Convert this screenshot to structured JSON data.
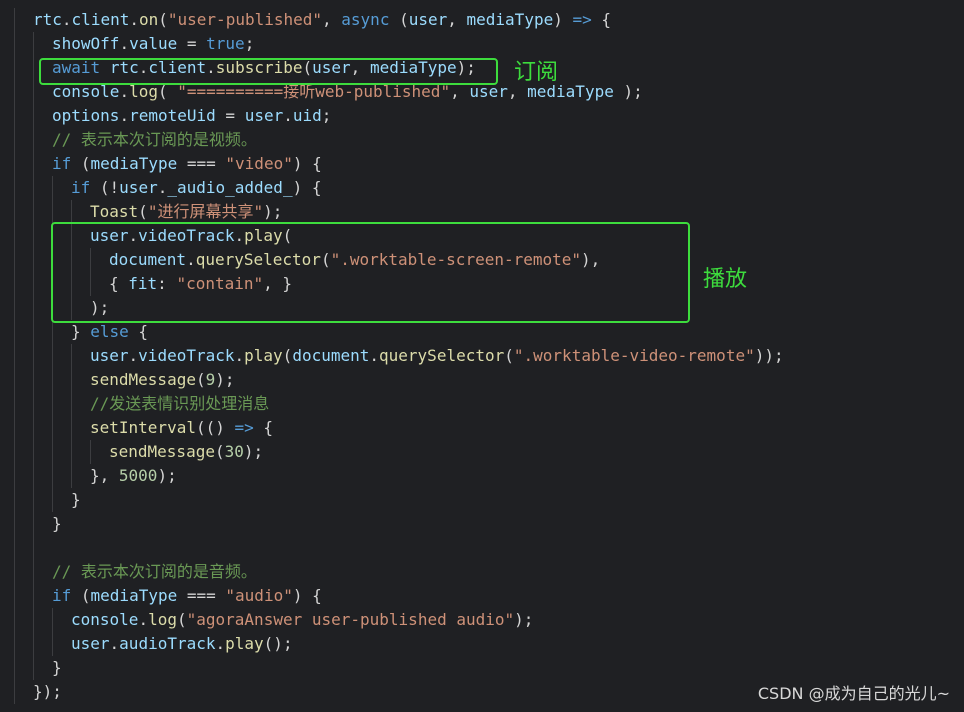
{
  "code": {
    "lines": [
      {
        "indent": 1,
        "tokens": [
          [
            "rtc",
            "var"
          ],
          [
            ".",
            "pun"
          ],
          [
            "client",
            "var"
          ],
          [
            ".",
            "pun"
          ],
          [
            "on",
            "fn"
          ],
          [
            "(",
            "pun"
          ],
          [
            "\"user-published\"",
            "str"
          ],
          [
            ", ",
            "pun"
          ],
          [
            "async",
            "kw"
          ],
          [
            " (",
            "pun"
          ],
          [
            "user",
            "var"
          ],
          [
            ", ",
            "pun"
          ],
          [
            "mediaType",
            "var"
          ],
          [
            ") ",
            "pun"
          ],
          [
            "=>",
            "kw"
          ],
          [
            " {",
            "pun"
          ]
        ]
      },
      {
        "indent": 2,
        "tokens": [
          [
            "showOff",
            "var"
          ],
          [
            ".",
            "pun"
          ],
          [
            "value",
            "var"
          ],
          [
            " = ",
            "pun"
          ],
          [
            "true",
            "kw"
          ],
          [
            ";",
            "pun"
          ]
        ]
      },
      {
        "indent": 2,
        "tokens": [
          [
            "await",
            "kw"
          ],
          [
            " ",
            "pun"
          ],
          [
            "rtc",
            "var"
          ],
          [
            ".",
            "pun"
          ],
          [
            "client",
            "var"
          ],
          [
            ".",
            "pun"
          ],
          [
            "subscribe",
            "fn"
          ],
          [
            "(",
            "pun"
          ],
          [
            "user",
            "var"
          ],
          [
            ", ",
            "pun"
          ],
          [
            "mediaType",
            "var"
          ],
          [
            ");",
            "pun"
          ]
        ]
      },
      {
        "indent": 2,
        "tokens": [
          [
            "console",
            "var"
          ],
          [
            ".",
            "pun"
          ],
          [
            "log",
            "fn"
          ],
          [
            "( ",
            "pun"
          ],
          [
            "\"==========接听web-published\"",
            "str"
          ],
          [
            ", ",
            "pun"
          ],
          [
            "user",
            "var"
          ],
          [
            ", ",
            "pun"
          ],
          [
            "mediaType",
            "var"
          ],
          [
            " );",
            "pun"
          ]
        ]
      },
      {
        "indent": 2,
        "tokens": [
          [
            "options",
            "var"
          ],
          [
            ".",
            "pun"
          ],
          [
            "remoteUid",
            "var"
          ],
          [
            " = ",
            "pun"
          ],
          [
            "user",
            "var"
          ],
          [
            ".",
            "pun"
          ],
          [
            "uid",
            "var"
          ],
          [
            ";",
            "pun"
          ]
        ]
      },
      {
        "indent": 2,
        "tokens": [
          [
            "// 表示本次订阅的是视频。",
            "cmt"
          ]
        ]
      },
      {
        "indent": 2,
        "tokens": [
          [
            "if",
            "kw"
          ],
          [
            " (",
            "pun"
          ],
          [
            "mediaType",
            "var"
          ],
          [
            " === ",
            "pun"
          ],
          [
            "\"video\"",
            "str"
          ],
          [
            ") {",
            "pun"
          ]
        ]
      },
      {
        "indent": 3,
        "tokens": [
          [
            "if",
            "kw"
          ],
          [
            " (!",
            "pun"
          ],
          [
            "user",
            "var"
          ],
          [
            ".",
            "pun"
          ],
          [
            "_audio_added_",
            "var"
          ],
          [
            ") {",
            "pun"
          ]
        ]
      },
      {
        "indent": 4,
        "tokens": [
          [
            "Toast",
            "fn"
          ],
          [
            "(",
            "pun"
          ],
          [
            "\"进行屏幕共享\"",
            "str"
          ],
          [
            ");",
            "pun"
          ]
        ]
      },
      {
        "indent": 4,
        "tokens": [
          [
            "user",
            "var"
          ],
          [
            ".",
            "pun"
          ],
          [
            "videoTrack",
            "var"
          ],
          [
            ".",
            "pun"
          ],
          [
            "play",
            "fn"
          ],
          [
            "(",
            "pun"
          ]
        ]
      },
      {
        "indent": 5,
        "tokens": [
          [
            "document",
            "var"
          ],
          [
            ".",
            "pun"
          ],
          [
            "querySelector",
            "fn"
          ],
          [
            "(",
            "pun"
          ],
          [
            "\".worktable-screen-remote\"",
            "str"
          ],
          [
            "),",
            "pun"
          ]
        ]
      },
      {
        "indent": 5,
        "tokens": [
          [
            "{ ",
            "pun"
          ],
          [
            "fit",
            "prop"
          ],
          [
            ": ",
            "pun"
          ],
          [
            "\"contain\"",
            "str"
          ],
          [
            ", }",
            "pun"
          ]
        ]
      },
      {
        "indent": 4,
        "tokens": [
          [
            ");",
            "pun"
          ]
        ]
      },
      {
        "indent": 3,
        "tokens": [
          [
            "} ",
            "pun"
          ],
          [
            "else",
            "kw"
          ],
          [
            " {",
            "pun"
          ]
        ]
      },
      {
        "indent": 4,
        "tokens": [
          [
            "user",
            "var"
          ],
          [
            ".",
            "pun"
          ],
          [
            "videoTrack",
            "var"
          ],
          [
            ".",
            "pun"
          ],
          [
            "play",
            "fn"
          ],
          [
            "(",
            "pun"
          ],
          [
            "document",
            "var"
          ],
          [
            ".",
            "pun"
          ],
          [
            "querySelector",
            "fn"
          ],
          [
            "(",
            "pun"
          ],
          [
            "\".worktable-video-remote\"",
            "str"
          ],
          [
            "));",
            "pun"
          ]
        ]
      },
      {
        "indent": 4,
        "tokens": [
          [
            "sendMessage",
            "fn"
          ],
          [
            "(",
            "pun"
          ],
          [
            "9",
            "num"
          ],
          [
            ");",
            "pun"
          ]
        ]
      },
      {
        "indent": 4,
        "tokens": [
          [
            "//发送表情识别处理消息",
            "cmt"
          ]
        ]
      },
      {
        "indent": 4,
        "tokens": [
          [
            "setInterval",
            "fn"
          ],
          [
            "(() ",
            "pun"
          ],
          [
            "=>",
            "kw"
          ],
          [
            " {",
            "pun"
          ]
        ]
      },
      {
        "indent": 5,
        "tokens": [
          [
            "sendMessage",
            "fn"
          ],
          [
            "(",
            "pun"
          ],
          [
            "30",
            "num"
          ],
          [
            ");",
            "pun"
          ]
        ]
      },
      {
        "indent": 4,
        "tokens": [
          [
            "}, ",
            "pun"
          ],
          [
            "5000",
            "num"
          ],
          [
            ");",
            "pun"
          ]
        ]
      },
      {
        "indent": 3,
        "tokens": [
          [
            "}",
            "pun"
          ]
        ]
      },
      {
        "indent": 2,
        "tokens": [
          [
            "}",
            "pun"
          ]
        ]
      },
      {
        "indent": 2,
        "tokens": []
      },
      {
        "indent": 2,
        "tokens": [
          [
            "// 表示本次订阅的是音频。",
            "cmt"
          ]
        ]
      },
      {
        "indent": 2,
        "tokens": [
          [
            "if",
            "kw"
          ],
          [
            " (",
            "pun"
          ],
          [
            "mediaType",
            "var"
          ],
          [
            " === ",
            "pun"
          ],
          [
            "\"audio\"",
            "str"
          ],
          [
            ") {",
            "pun"
          ]
        ]
      },
      {
        "indent": 3,
        "tokens": [
          [
            "console",
            "var"
          ],
          [
            ".",
            "pun"
          ],
          [
            "log",
            "fn"
          ],
          [
            "(",
            "pun"
          ],
          [
            "\"agoraAnswer user-published audio\"",
            "str"
          ],
          [
            ");",
            "pun"
          ]
        ]
      },
      {
        "indent": 3,
        "tokens": [
          [
            "user",
            "var"
          ],
          [
            ".",
            "pun"
          ],
          [
            "audioTrack",
            "var"
          ],
          [
            ".",
            "pun"
          ],
          [
            "play",
            "fn"
          ],
          [
            "();",
            "pun"
          ]
        ]
      },
      {
        "indent": 2,
        "tokens": [
          [
            "}",
            "pun"
          ]
        ]
      },
      {
        "indent": 1,
        "tokens": [
          [
            "});",
            "pun"
          ]
        ]
      }
    ]
  },
  "annotations": {
    "subscribe_label": "订阅",
    "play_label": "播放"
  },
  "watermark": "CSDN @成为自己的光儿~",
  "colors": {
    "background": "#1f2023",
    "highlight": "#3ddc3d"
  }
}
